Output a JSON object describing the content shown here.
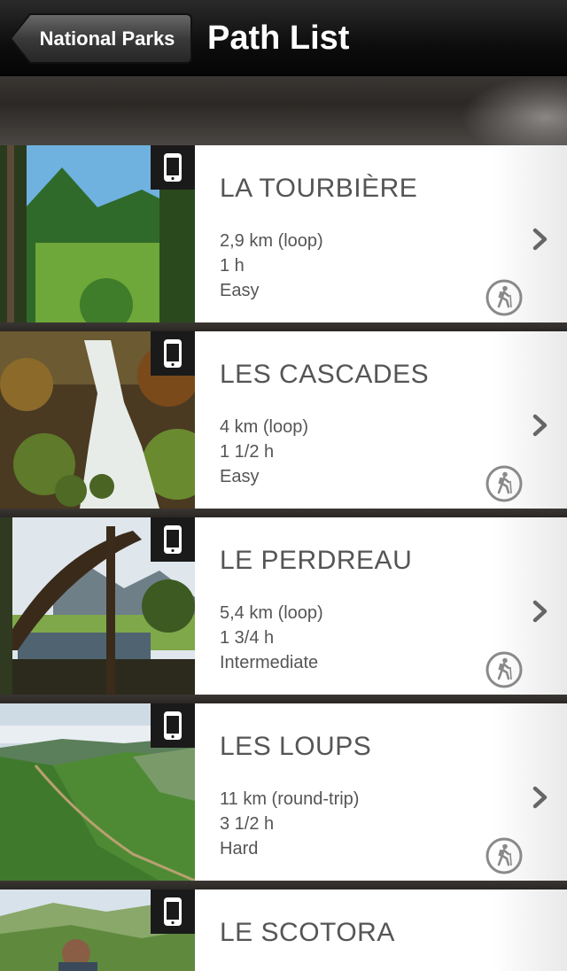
{
  "navbar": {
    "back_label": "National Parks",
    "title": "Path List"
  },
  "trails": [
    {
      "name": "LA TOURBIÈRE",
      "distance": "2,9 km (loop)",
      "duration": "1 h",
      "difficulty": "Easy"
    },
    {
      "name": "LES CASCADES",
      "distance": "4 km (loop)",
      "duration": "1 1/2 h",
      "difficulty": "Easy"
    },
    {
      "name": "LE PERDREAU",
      "distance": "5,4 km (loop)",
      "duration": "1 3/4 h",
      "difficulty": "Intermediate"
    },
    {
      "name": "LES LOUPS",
      "distance": "11 km (round-trip)",
      "duration": "3 1/2 h",
      "difficulty": "Hard"
    },
    {
      "name": "LE SCOTORA",
      "distance": "",
      "duration": "",
      "difficulty": ""
    }
  ],
  "icons": {
    "back": "back-arrow-button",
    "device": "mobile-phone-icon",
    "chevron": "chevron-right-icon",
    "hiker": "hiker-icon"
  }
}
